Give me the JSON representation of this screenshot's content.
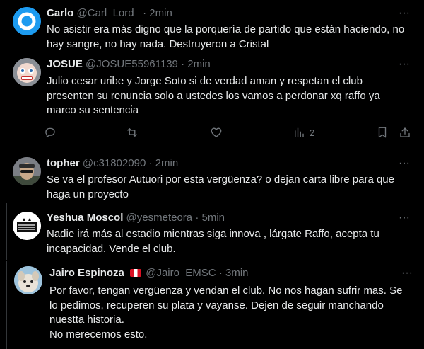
{
  "tweets": [
    {
      "name": "Carlo",
      "handle": "@Carl_Lord_",
      "time": "2min",
      "text": "No asistir era más digno que la porquería de partido que están haciendo, no hay sangre, no hay nada. Destruyeron a Cristal"
    },
    {
      "name": "JOSUE",
      "handle": "@JOSUE55961139",
      "time": "2min",
      "text": "Julio cesar uribe y Jorge Soto si de verdad aman y respetan el club\npresenten su renuncia solo a ustedes los vamos a perdonar xq raffo ya\nmarco su sentencia",
      "actions": {
        "views_count": "2"
      }
    },
    {
      "name": "topher",
      "handle": "@c31802090",
      "time": "2min",
      "text": "Se va el profesor Autuori por esta vergüenza? o dejan carta libre para que\nhaga un proyecto"
    },
    {
      "name": "Yeshua Moscol",
      "handle": "@yesmeteora",
      "time": "5min",
      "text": "Nadie irá más al estadio mientras siga innova , lárgate Raffo, acepta tu\nincapacidad. Vende el club.",
      "avatar_text": "INNOVA NO ES CRISTAL"
    },
    {
      "name": "Jairo Espinoza",
      "handle": "@Jairo_EMSC",
      "time": "3min",
      "text": "Por favor, tengan vergüenza y vendan el club. No nos hagan sufrir mas. Se\nlo pedimos, recuperen su plata y vayanse. Dejen de seguir manchando\nnuestta historia.\nNo merecemos esto."
    }
  ],
  "separator": "·",
  "more_glyph": "···",
  "colors": {
    "background": "#000000",
    "text": "#e7e9ea",
    "muted": "#71767b",
    "divider": "#2f3336"
  }
}
